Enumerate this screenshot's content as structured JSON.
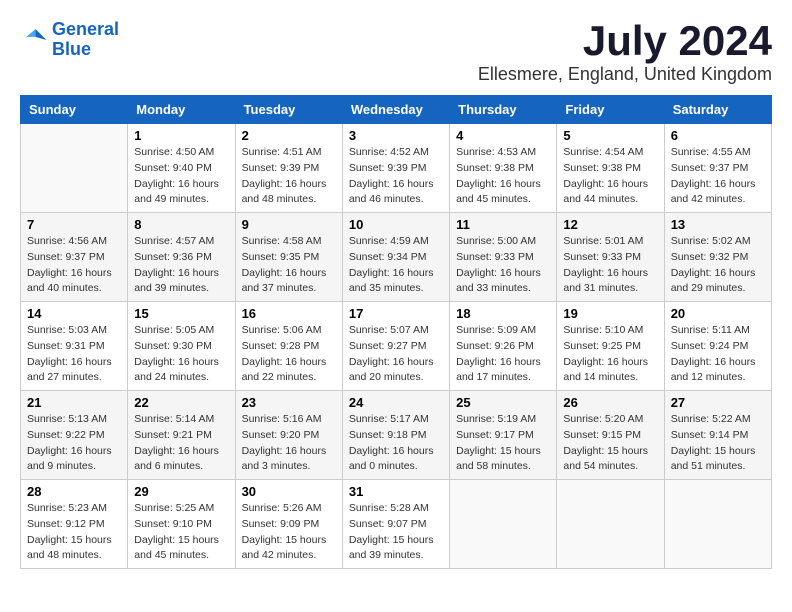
{
  "logo": {
    "line1": "General",
    "line2": "Blue"
  },
  "title": "July 2024",
  "location": "Ellesmere, England, United Kingdom",
  "days_of_week": [
    "Sunday",
    "Monday",
    "Tuesday",
    "Wednesday",
    "Thursday",
    "Friday",
    "Saturday"
  ],
  "weeks": [
    [
      {
        "day": "",
        "sunrise": "",
        "sunset": "",
        "daylight": ""
      },
      {
        "day": "1",
        "sunrise": "Sunrise: 4:50 AM",
        "sunset": "Sunset: 9:40 PM",
        "daylight": "Daylight: 16 hours and 49 minutes."
      },
      {
        "day": "2",
        "sunrise": "Sunrise: 4:51 AM",
        "sunset": "Sunset: 9:39 PM",
        "daylight": "Daylight: 16 hours and 48 minutes."
      },
      {
        "day": "3",
        "sunrise": "Sunrise: 4:52 AM",
        "sunset": "Sunset: 9:39 PM",
        "daylight": "Daylight: 16 hours and 46 minutes."
      },
      {
        "day": "4",
        "sunrise": "Sunrise: 4:53 AM",
        "sunset": "Sunset: 9:38 PM",
        "daylight": "Daylight: 16 hours and 45 minutes."
      },
      {
        "day": "5",
        "sunrise": "Sunrise: 4:54 AM",
        "sunset": "Sunset: 9:38 PM",
        "daylight": "Daylight: 16 hours and 44 minutes."
      },
      {
        "day": "6",
        "sunrise": "Sunrise: 4:55 AM",
        "sunset": "Sunset: 9:37 PM",
        "daylight": "Daylight: 16 hours and 42 minutes."
      }
    ],
    [
      {
        "day": "7",
        "sunrise": "Sunrise: 4:56 AM",
        "sunset": "Sunset: 9:37 PM",
        "daylight": "Daylight: 16 hours and 40 minutes."
      },
      {
        "day": "8",
        "sunrise": "Sunrise: 4:57 AM",
        "sunset": "Sunset: 9:36 PM",
        "daylight": "Daylight: 16 hours and 39 minutes."
      },
      {
        "day": "9",
        "sunrise": "Sunrise: 4:58 AM",
        "sunset": "Sunset: 9:35 PM",
        "daylight": "Daylight: 16 hours and 37 minutes."
      },
      {
        "day": "10",
        "sunrise": "Sunrise: 4:59 AM",
        "sunset": "Sunset: 9:34 PM",
        "daylight": "Daylight: 16 hours and 35 minutes."
      },
      {
        "day": "11",
        "sunrise": "Sunrise: 5:00 AM",
        "sunset": "Sunset: 9:33 PM",
        "daylight": "Daylight: 16 hours and 33 minutes."
      },
      {
        "day": "12",
        "sunrise": "Sunrise: 5:01 AM",
        "sunset": "Sunset: 9:33 PM",
        "daylight": "Daylight: 16 hours and 31 minutes."
      },
      {
        "day": "13",
        "sunrise": "Sunrise: 5:02 AM",
        "sunset": "Sunset: 9:32 PM",
        "daylight": "Daylight: 16 hours and 29 minutes."
      }
    ],
    [
      {
        "day": "14",
        "sunrise": "Sunrise: 5:03 AM",
        "sunset": "Sunset: 9:31 PM",
        "daylight": "Daylight: 16 hours and 27 minutes."
      },
      {
        "day": "15",
        "sunrise": "Sunrise: 5:05 AM",
        "sunset": "Sunset: 9:30 PM",
        "daylight": "Daylight: 16 hours and 24 minutes."
      },
      {
        "day": "16",
        "sunrise": "Sunrise: 5:06 AM",
        "sunset": "Sunset: 9:28 PM",
        "daylight": "Daylight: 16 hours and 22 minutes."
      },
      {
        "day": "17",
        "sunrise": "Sunrise: 5:07 AM",
        "sunset": "Sunset: 9:27 PM",
        "daylight": "Daylight: 16 hours and 20 minutes."
      },
      {
        "day": "18",
        "sunrise": "Sunrise: 5:09 AM",
        "sunset": "Sunset: 9:26 PM",
        "daylight": "Daylight: 16 hours and 17 minutes."
      },
      {
        "day": "19",
        "sunrise": "Sunrise: 5:10 AM",
        "sunset": "Sunset: 9:25 PM",
        "daylight": "Daylight: 16 hours and 14 minutes."
      },
      {
        "day": "20",
        "sunrise": "Sunrise: 5:11 AM",
        "sunset": "Sunset: 9:24 PM",
        "daylight": "Daylight: 16 hours and 12 minutes."
      }
    ],
    [
      {
        "day": "21",
        "sunrise": "Sunrise: 5:13 AM",
        "sunset": "Sunset: 9:22 PM",
        "daylight": "Daylight: 16 hours and 9 minutes."
      },
      {
        "day": "22",
        "sunrise": "Sunrise: 5:14 AM",
        "sunset": "Sunset: 9:21 PM",
        "daylight": "Daylight: 16 hours and 6 minutes."
      },
      {
        "day": "23",
        "sunrise": "Sunrise: 5:16 AM",
        "sunset": "Sunset: 9:20 PM",
        "daylight": "Daylight: 16 hours and 3 minutes."
      },
      {
        "day": "24",
        "sunrise": "Sunrise: 5:17 AM",
        "sunset": "Sunset: 9:18 PM",
        "daylight": "Daylight: 16 hours and 0 minutes."
      },
      {
        "day": "25",
        "sunrise": "Sunrise: 5:19 AM",
        "sunset": "Sunset: 9:17 PM",
        "daylight": "Daylight: 15 hours and 58 minutes."
      },
      {
        "day": "26",
        "sunrise": "Sunrise: 5:20 AM",
        "sunset": "Sunset: 9:15 PM",
        "daylight": "Daylight: 15 hours and 54 minutes."
      },
      {
        "day": "27",
        "sunrise": "Sunrise: 5:22 AM",
        "sunset": "Sunset: 9:14 PM",
        "daylight": "Daylight: 15 hours and 51 minutes."
      }
    ],
    [
      {
        "day": "28",
        "sunrise": "Sunrise: 5:23 AM",
        "sunset": "Sunset: 9:12 PM",
        "daylight": "Daylight: 15 hours and 48 minutes."
      },
      {
        "day": "29",
        "sunrise": "Sunrise: 5:25 AM",
        "sunset": "Sunset: 9:10 PM",
        "daylight": "Daylight: 15 hours and 45 minutes."
      },
      {
        "day": "30",
        "sunrise": "Sunrise: 5:26 AM",
        "sunset": "Sunset: 9:09 PM",
        "daylight": "Daylight: 15 hours and 42 minutes."
      },
      {
        "day": "31",
        "sunrise": "Sunrise: 5:28 AM",
        "sunset": "Sunset: 9:07 PM",
        "daylight": "Daylight: 15 hours and 39 minutes."
      },
      {
        "day": "",
        "sunrise": "",
        "sunset": "",
        "daylight": ""
      },
      {
        "day": "",
        "sunrise": "",
        "sunset": "",
        "daylight": ""
      },
      {
        "day": "",
        "sunrise": "",
        "sunset": "",
        "daylight": ""
      }
    ]
  ]
}
